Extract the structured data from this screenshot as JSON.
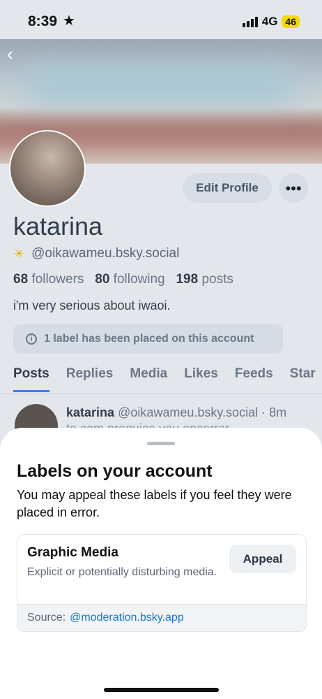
{
  "status_bar": {
    "time": "8:39",
    "network": "4G",
    "battery": "46"
  },
  "profile": {
    "display_name": "katarina",
    "handle": "@oikawameu.bsky.social",
    "followers_count": "68",
    "followers_label": "followers",
    "following_count": "80",
    "following_label": "following",
    "posts_count": "198",
    "posts_label": "posts",
    "bio": "i'm very serious about iwaoi.",
    "edit_button": "Edit Profile",
    "more_button": "•••",
    "label_notice": "1 label has been placed on this account"
  },
  "tabs": [
    {
      "label": "Posts",
      "active": true
    },
    {
      "label": "Replies"
    },
    {
      "label": "Media"
    },
    {
      "label": "Likes"
    },
    {
      "label": "Feeds"
    },
    {
      "label": "Star"
    }
  ],
  "post_preview": {
    "author": "katarina",
    "handle": "@oikawameu.bsky.social",
    "time": "· 8m",
    "text": "te com preguiçe vou encerrar"
  },
  "sheet": {
    "title": "Labels on your account",
    "description": "You may appeal these labels if you feel they were placed in error.",
    "label_card": {
      "title": "Graphic Media",
      "description": "Explicit or potentially disturbing media.",
      "appeal_button": "Appeal",
      "source_label": "Source:",
      "source_link": "@moderation.bsky.app"
    }
  },
  "colors": {
    "accent": "#3b82d6",
    "link": "#1a75d2",
    "battery": "#f5d90a"
  }
}
